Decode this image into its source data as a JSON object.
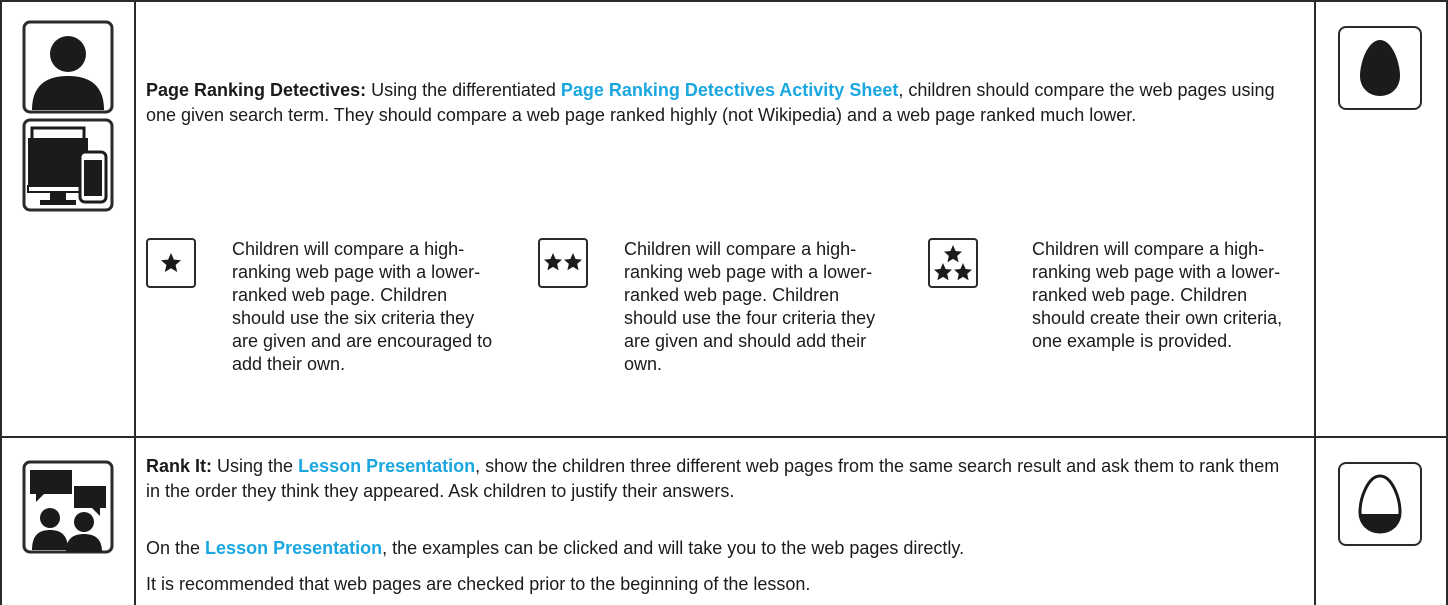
{
  "row1": {
    "icons": {
      "person": "person-icon",
      "devices": "devices-icon",
      "egg": "full-egg-icon"
    },
    "title": "Page Ranking Detectives:",
    "text_before_link": " Using the differentiated ",
    "link": "Page Ranking Detectives Activity Sheet",
    "text_after_link": ", children should compare the web pages using one given search term. They should compare a web page ranked highly (not Wikipedia) and a web page ranked much lower.",
    "tiers": [
      {
        "stars": 1,
        "icon": "one-star-icon",
        "text": "Children will compare a high-ranking web page with a lower-ranked web page. Children should use the six criteria they are given and are encouraged to add their own."
      },
      {
        "stars": 2,
        "icon": "two-star-icon",
        "text": "Children will compare a high-ranking web page with a lower-ranked web page. Children should use the four criteria they are given and should add their own."
      },
      {
        "stars": 3,
        "icon": "three-star-icon",
        "text": "Children will compare a high-ranking web page with a lower-ranked web page. Children should create their own criteria, one example is provided."
      }
    ]
  },
  "row2": {
    "icons": {
      "discussion": "discussion-icon",
      "egg": "half-egg-icon"
    },
    "title": "Rank It:",
    "p1_before": " Using the ",
    "p1_link": "Lesson Presentation",
    "p1_after": ", show the children three different web pages from the same search result and ask them to rank them in the order they think they appeared. Ask children to justify their answers.",
    "p2_before": "On the ",
    "p2_link": "Lesson Presentation",
    "p2_after": ", the examples can be clicked and will take you to the web pages directly.",
    "p3": "It is recommended that web pages are checked prior to the beginning of the lesson."
  },
  "colors": {
    "link": "#1aa7e0",
    "ink": "#1b1b1b",
    "border": "#2a2a2a"
  }
}
